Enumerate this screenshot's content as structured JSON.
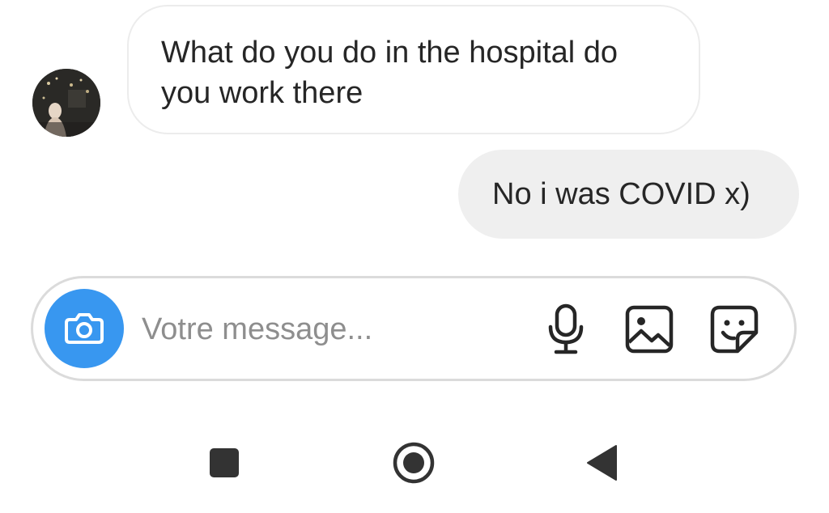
{
  "thread": {
    "incoming_message": "What do you do in the hospital do you work there",
    "outgoing_message": "No i was COVID x)"
  },
  "composer": {
    "placeholder": "Votre message...",
    "accent_color": "#3897f0",
    "icons": [
      "camera-icon",
      "microphone-icon",
      "gallery-icon",
      "sticker-icon"
    ]
  },
  "navigation_bar": {
    "buttons": [
      "recents-icon",
      "home-icon",
      "back-icon"
    ]
  }
}
